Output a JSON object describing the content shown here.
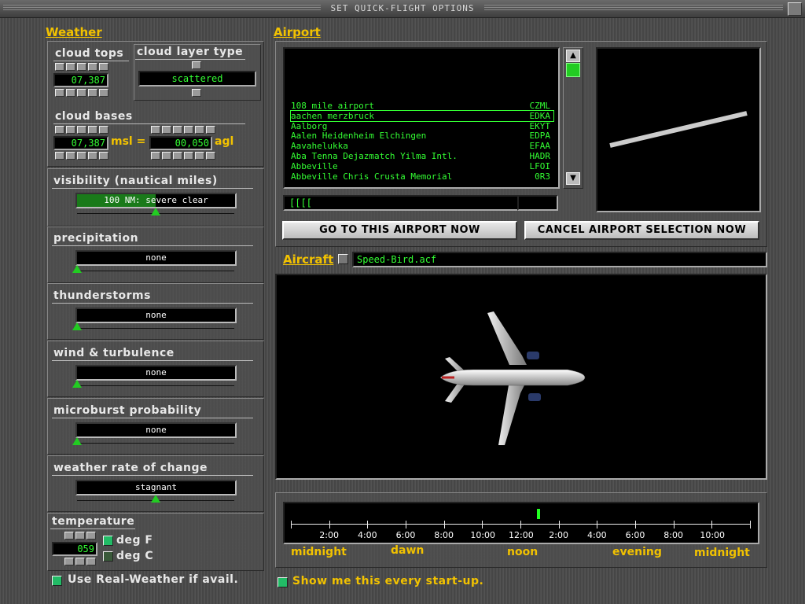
{
  "window": {
    "title": "SET QUICK-FLIGHT OPTIONS"
  },
  "weather": {
    "section_label": "Weather",
    "cloud_tops": {
      "label": "cloud tops",
      "value": "07,387"
    },
    "cloud_layer_type": {
      "label": "cloud layer type",
      "value": "scattered"
    },
    "cloud_bases": {
      "label": "cloud bases",
      "msl_value": "07,387",
      "msl_label": "msl =",
      "agl_value": "00,050",
      "agl_label": "agl"
    },
    "visibility": {
      "label": "visibility (nautical miles)",
      "value": "100 NM: severe clear",
      "level": 0.5
    },
    "precipitation": {
      "label": "precipitation",
      "value": "none",
      "level": 0
    },
    "thunderstorms": {
      "label": "thunderstorms",
      "value": "none",
      "level": 0
    },
    "wind": {
      "label": "wind & turbulence",
      "value": "none",
      "level": 0
    },
    "microburst": {
      "label": "microburst probability",
      "value": "none",
      "level": 0
    },
    "rate_of_change": {
      "label": "weather rate of change",
      "value": "stagnant",
      "level": 0.5
    },
    "temperature": {
      "label": "temperature",
      "value": "059",
      "deg_f": "deg F",
      "deg_c": "deg C"
    },
    "real_weather": {
      "label": "Use Real-Weather if avail.",
      "checked": true
    }
  },
  "airport": {
    "section_label": "Airport",
    "list": [
      {
        "name": "108 mile airport",
        "code": "CZML"
      },
      {
        "name": "aachen merzbruck",
        "code": "EDKA",
        "selected": true
      },
      {
        "name": "Aalborg",
        "code": "EKYT"
      },
      {
        "name": "Aalen Heidenheim Elchingen",
        "code": "EDPA"
      },
      {
        "name": "Aavahelukka",
        "code": "EFAA"
      },
      {
        "name": "Aba Tenna Dejazmatch Yilma Intl.",
        "code": "HADR"
      },
      {
        "name": "Abbeville",
        "code": "LFOI"
      },
      {
        "name": "Abbeville Chris Crusta Memorial",
        "code": "0R3"
      }
    ],
    "search_value": "[[[[",
    "go_button": "GO TO THIS AIRPORT NOW",
    "cancel_button": "CANCEL AIRPORT SELECTION NOW"
  },
  "aircraft": {
    "section_label": "Aircraft",
    "file": "Speed-Bird.acf"
  },
  "time": {
    "tick_labels": [
      "2:00",
      "4:00",
      "6:00",
      "8:00",
      "10:00",
      "12:00",
      "2:00",
      "4:00",
      "6:00",
      "8:00",
      "10:00"
    ],
    "periods": [
      "midnight",
      "dawn",
      "noon",
      "evening",
      "midnight"
    ],
    "current_fraction": 0.54
  },
  "startup": {
    "label": "Show me this every start-up.",
    "checked": true
  },
  "colors": {
    "accent": "#f2c200",
    "digit": "#33ff33"
  }
}
